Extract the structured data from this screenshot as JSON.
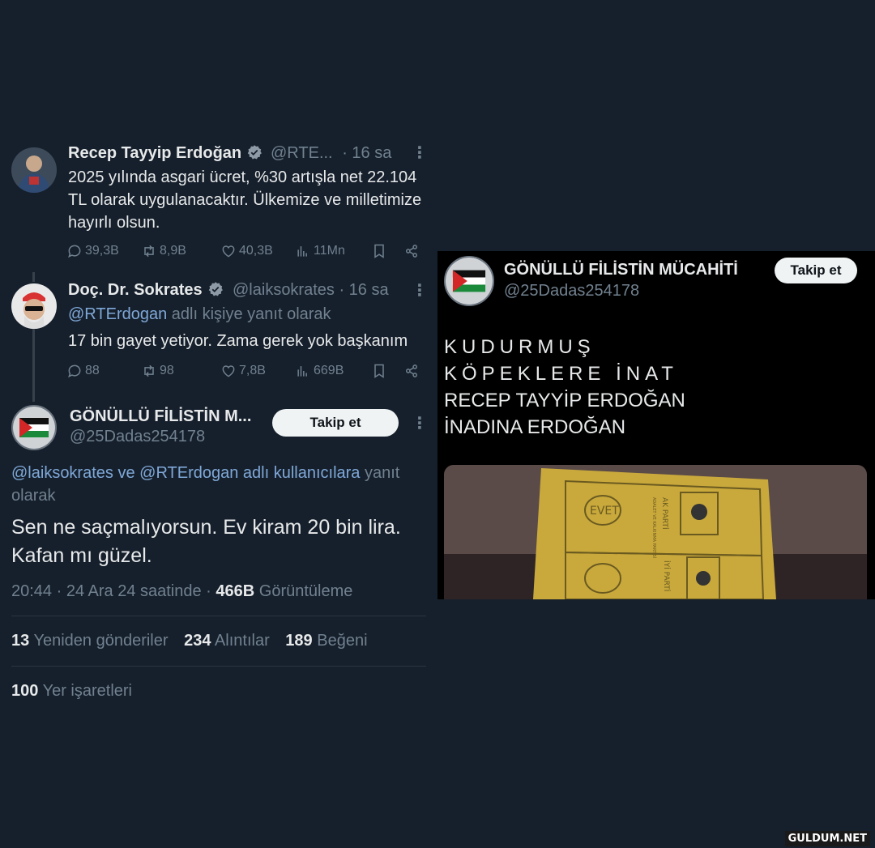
{
  "tweets": [
    {
      "name": "Recep Tayyip Erdoğan",
      "handle": "@RTE...",
      "time": "· 16 sa",
      "text": "2025 yılında asgari ücret, %30 artışla net 22.104 TL olarak uygulanacaktır. Ülkemize ve milletimize hayırlı olsun.",
      "reply_count": "39,3B",
      "retweet_count": "8,9B",
      "like_count": "40,3B",
      "view_count": "11Mn"
    },
    {
      "name": "Doç. Dr. Sokrates",
      "handle": "@laiksokrates",
      "time": "· 16 sa",
      "reply_to_mention": "@RTErdogan",
      "reply_to_suffix": "adlı kişiye yanıt olarak",
      "text": "17 bin gayet yetiyor. Zama gerek yok başkanım",
      "reply_count": "88",
      "retweet_count": "98",
      "like_count": "7,8B",
      "view_count": "669B"
    }
  ],
  "main_tweet": {
    "name": "GÖNÜLLÜ FİLİSTİN M...",
    "handle": "@25Dadas254178",
    "follow_label": "Takip et",
    "reply_to_mentions": "@laiksokrates ve @RTErdogan adlı kullanıcılara",
    "reply_to_suffix": "yanıt",
    "reply_to_suffix2": "olarak",
    "text_line1": "Sen ne saçmalıyorsun. Ev kiram 20 bin lira.",
    "text_line2": "Kafan mı güzel.",
    "timestamp": "20:44 · 24 Ara 24 saatinde ·",
    "views_count": "466B",
    "views_label": "Görüntüleme",
    "retweets_count": "13",
    "retweets_label": "Yeniden gönderiler",
    "quotes_count": "234",
    "quotes_label": "Alıntılar",
    "likes_count": "189",
    "likes_label": "Beğeni",
    "bookmarks_count": "100",
    "bookmarks_label": "Yer işaretleri"
  },
  "embedded_profile": {
    "name": "GÖNÜLLÜ FİLİSTİN MÜCAHİTİ",
    "handle": "@25Dadas254178",
    "follow_label": "Takip et",
    "lines": [
      "KUDURMUŞ",
      "KÖPEKLERE İNAT",
      "RECEP TAYYİP ERDOĞAN",
      "İNADINA ERDOĞAN"
    ],
    "photo_labels": {
      "stamp": "EVET",
      "party1": "AK PARTİ",
      "party1_sub": "ADALET VE KALKINMA PARTİSİ",
      "party2": "İYİ PARTİ"
    }
  },
  "watermark": "GULDUM.NET",
  "colors": {
    "background": "#16202c",
    "text": "#e7e9ea",
    "muted": "#71818f",
    "link": "#7fa8d8",
    "verified": "#8e9aa6",
    "button": "#eff3f4"
  }
}
